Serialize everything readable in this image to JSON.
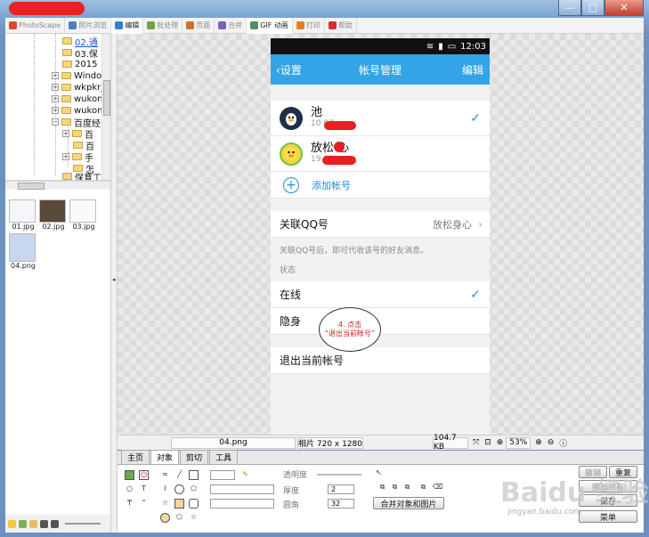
{
  "window": {
    "buttons": [
      "—",
      "□",
      "✕"
    ]
  },
  "menubar": {
    "tabs": [
      {
        "label": "PhotoScape",
        "active": false,
        "color": "#d94a2a"
      },
      {
        "label": "照片浏览",
        "active": false,
        "color": "#4a7fc0"
      },
      {
        "label": "编辑",
        "active": true,
        "color": "#3a7fd0"
      },
      {
        "label": "批处理",
        "active": false,
        "color": "#6fa050"
      },
      {
        "label": "页面",
        "active": false,
        "color": "#d07030"
      },
      {
        "label": "合并",
        "active": false,
        "color": "#7a60c0"
      },
      {
        "label": "GIF 动画",
        "active": true,
        "color": "#509060"
      },
      {
        "label": "打印",
        "active": false,
        "color": "#e08020"
      },
      {
        "label": "帮助",
        "active": false,
        "color": "#d03030"
      }
    ]
  },
  "tree": {
    "items": [
      {
        "label": "02.通",
        "highlight": true
      },
      {
        "label": "03.保"
      },
      {
        "label": "2015"
      },
      {
        "label": "Windo"
      },
      {
        "label": "wkpkrj"
      },
      {
        "label": "wukon"
      },
      {
        "label": "wukon"
      },
      {
        "label": "百度经"
      },
      {
        "label": "百"
      },
      {
        "label": "百"
      },
      {
        "label": "手"
      },
      {
        "label": "怎"
      },
      {
        "label": "保育工"
      }
    ]
  },
  "thumbnails": [
    {
      "label": "01.jpg"
    },
    {
      "label": "02.jpg"
    },
    {
      "label": "03.jpg"
    },
    {
      "label": "04.png"
    }
  ],
  "phone": {
    "status_time": "12:03",
    "app_title": "帐号管理",
    "back_label": "设置",
    "edit_label": "编辑",
    "accounts": [
      {
        "name": "池",
        "number": "10             07",
        "checked": true
      },
      {
        "name": "放松  心",
        "number": "19             93",
        "checked": false
      }
    ],
    "add_account": "添加帐号",
    "link_qq_label": "关联QQ号",
    "link_qq_value": "放松身心",
    "link_hint": "关联QQ号后，即可代收该号的好友消息。",
    "status_header": "状态",
    "online_label": "在线",
    "hidden_label": "隐身",
    "logout_label": "退出当前帐号",
    "callout_line1": "4. 点击",
    "callout_line2": "“退出当前帐号”"
  },
  "status_strip": {
    "filename": "04.png",
    "info": "相片 720 x 1280",
    "size": "104.7 KB",
    "zoom": "53%"
  },
  "tool_tabs": [
    "主页",
    "对象",
    "剪切",
    "工具"
  ],
  "tools": {
    "opacity_label": "透明度",
    "thickness_label": "厚度",
    "thickness_value": "2",
    "radius_label": "圆角",
    "radius_value": "32",
    "combine_label": "合并对象和图片",
    "undo_label": "撤销",
    "redo_label": "重复",
    "undo_all_label": "撤销所有",
    "save_label": "保存",
    "menu_label": "菜单"
  },
  "watermark": {
    "text": "Baidu 经验",
    "sub": "jingyan.baidu.com"
  }
}
